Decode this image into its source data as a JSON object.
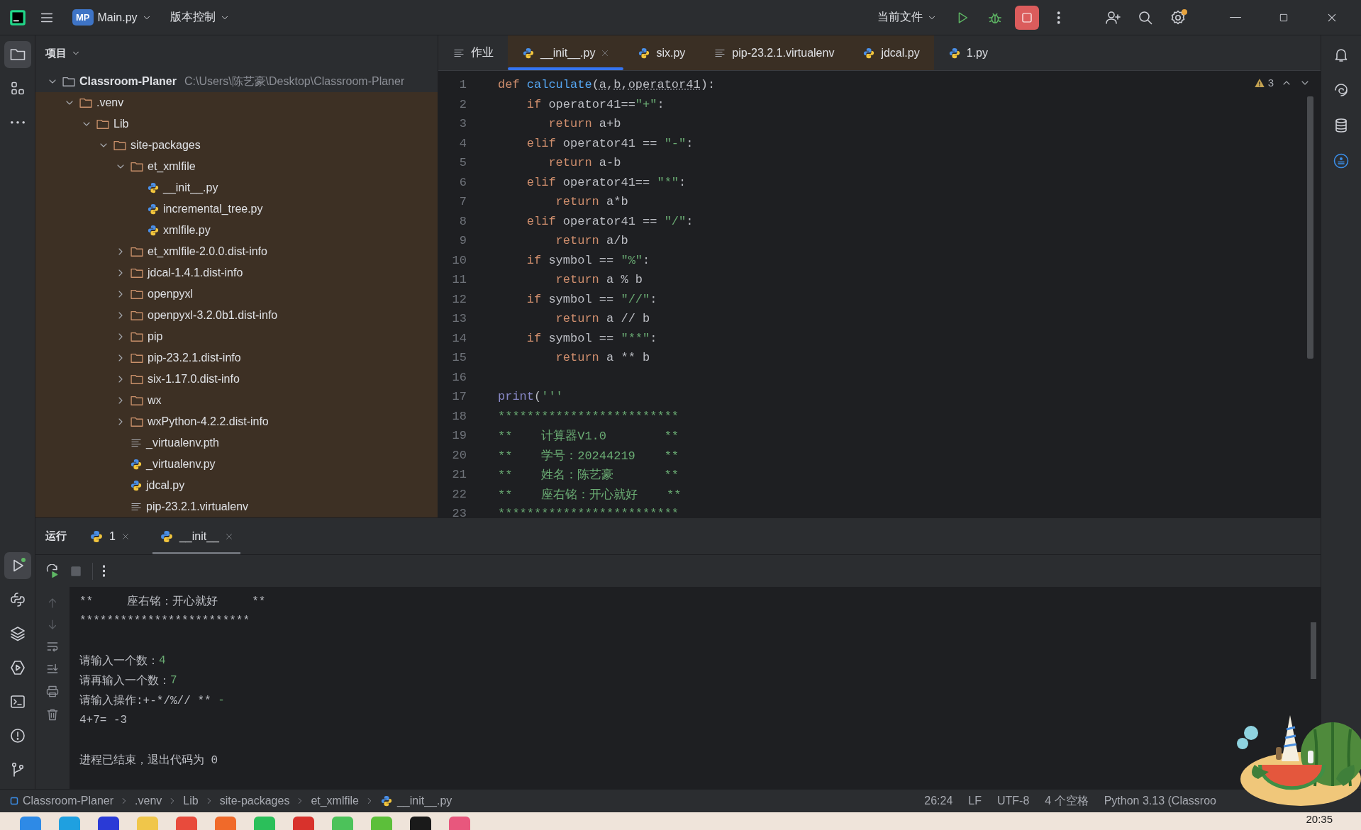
{
  "title_bar": {
    "project_badge": "MP",
    "project": "Main.py",
    "vcs": "版本控制",
    "run_config": "当前文件"
  },
  "left_stripe": {
    "top": [
      {
        "kind": "project",
        "selected": true
      },
      {
        "kind": "structure",
        "selected": false
      },
      {
        "kind": "more",
        "selected": false
      }
    ],
    "bottom": [
      {
        "kind": "run",
        "selected": true
      },
      {
        "kind": "python",
        "selected": false
      },
      {
        "kind": "layers",
        "selected": false
      },
      {
        "kind": "services",
        "selected": false
      },
      {
        "kind": "terminal",
        "selected": false
      },
      {
        "kind": "problems",
        "selected": false
      },
      {
        "kind": "git",
        "selected": false
      }
    ]
  },
  "right_stripe": [
    {
      "kind": "notifications"
    },
    {
      "kind": "ai"
    },
    {
      "kind": "database"
    },
    {
      "kind": "plugin"
    }
  ],
  "project_panel": {
    "title": "项目",
    "tree": [
      {
        "label": "Classroom-Planer",
        "path": "C:\\Users\\陈艺豪\\Desktop\\Classroom-Planer",
        "kind": "folder",
        "expanded": true,
        "children": [
          {
            "label": ".venv",
            "kind": "folder",
            "expanded": true,
            "excluded": true,
            "children": [
              {
                "label": "Lib",
                "kind": "folder",
                "expanded": true,
                "children": [
                  {
                    "label": "site-packages",
                    "kind": "folder",
                    "expanded": true,
                    "children": [
                      {
                        "label": "et_xmlfile",
                        "kind": "folder",
                        "expanded": true,
                        "children": [
                          {
                            "label": "__init__.py",
                            "kind": "python"
                          },
                          {
                            "label": "incremental_tree.py",
                            "kind": "python"
                          },
                          {
                            "label": "xmlfile.py",
                            "kind": "python"
                          }
                        ]
                      },
                      {
                        "label": "et_xmlfile-2.0.0.dist-info",
                        "kind": "folder",
                        "expanded": false
                      },
                      {
                        "label": "jdcal-1.4.1.dist-info",
                        "kind": "folder",
                        "expanded": false
                      },
                      {
                        "label": "openpyxl",
                        "kind": "folder",
                        "expanded": false
                      },
                      {
                        "label": "openpyxl-3.2.0b1.dist-info",
                        "kind": "folder",
                        "expanded": false
                      },
                      {
                        "label": "pip",
                        "kind": "folder",
                        "expanded": false
                      },
                      {
                        "label": "pip-23.2.1.dist-info",
                        "kind": "folder",
                        "expanded": false
                      },
                      {
                        "label": "six-1.17.0.dist-info",
                        "kind": "folder",
                        "expanded": false
                      },
                      {
                        "label": "wx",
                        "kind": "folder",
                        "expanded": false
                      },
                      {
                        "label": "wxPython-4.2.2.dist-info",
                        "kind": "folder",
                        "expanded": false
                      },
                      {
                        "label": "_virtualenv.pth",
                        "kind": "text"
                      },
                      {
                        "label": "_virtualenv.py",
                        "kind": "python"
                      },
                      {
                        "label": "jdcal.py",
                        "kind": "python"
                      },
                      {
                        "label": "pip-23.2.1.virtualenv",
                        "kind": "text"
                      }
                    ]
                  }
                ]
              }
            ]
          }
        ]
      }
    ]
  },
  "editor_tabs": [
    {
      "label": "作业",
      "kind": "text",
      "selected": false,
      "excluded": false
    },
    {
      "label": "__init__.py",
      "kind": "python",
      "selected": true,
      "excluded": true
    },
    {
      "label": "six.py",
      "kind": "python",
      "selected": false,
      "excluded": true
    },
    {
      "label": "pip-23.2.1.virtualenv",
      "kind": "text",
      "selected": false,
      "excluded": true
    },
    {
      "label": "jdcal.py",
      "kind": "python",
      "selected": false,
      "excluded": true
    },
    {
      "label": "1.py",
      "kind": "python",
      "selected": false,
      "excluded": false
    }
  ],
  "editor": {
    "warnings": "3",
    "lines": [
      {
        "number": "1",
        "tokens": [
          {
            "kind": "keyword",
            "text": "def "
          },
          {
            "kind": "function",
            "text": "calculate"
          },
          {
            "kind": "plain",
            "text": "("
          },
          {
            "kind": "param",
            "text": "a"
          },
          {
            "kind": "plain",
            "text": ","
          },
          {
            "kind": "param",
            "text": "b"
          },
          {
            "kind": "plain",
            "text": ","
          },
          {
            "kind": "param",
            "text": "operator41"
          },
          {
            "kind": "plain",
            "text": "):"
          }
        ]
      },
      {
        "number": "2",
        "tokens": [
          {
            "kind": "keyword",
            "text": "    if"
          },
          {
            "kind": "plain",
            "text": " operator41=="
          },
          {
            "kind": "string",
            "text": "\"+\""
          },
          {
            "kind": "plain",
            "text": ":"
          }
        ]
      },
      {
        "number": "3",
        "tokens": [
          {
            "kind": "keyword",
            "text": "       return"
          },
          {
            "kind": "plain",
            "text": " a+b"
          }
        ]
      },
      {
        "number": "4",
        "tokens": [
          {
            "kind": "keyword",
            "text": "    elif"
          },
          {
            "kind": "plain",
            "text": " operator41 == "
          },
          {
            "kind": "string",
            "text": "\"-\""
          },
          {
            "kind": "plain",
            "text": ":"
          }
        ]
      },
      {
        "number": "5",
        "tokens": [
          {
            "kind": "keyword",
            "text": "       return"
          },
          {
            "kind": "plain",
            "text": " a-b"
          }
        ]
      },
      {
        "number": "6",
        "tokens": [
          {
            "kind": "keyword",
            "text": "    elif"
          },
          {
            "kind": "plain",
            "text": " operator41== "
          },
          {
            "kind": "string",
            "text": "\"*\""
          },
          {
            "kind": "plain",
            "text": ":"
          }
        ]
      },
      {
        "number": "7",
        "tokens": [
          {
            "kind": "keyword",
            "text": "        return"
          },
          {
            "kind": "plain",
            "text": " a*b"
          }
        ]
      },
      {
        "number": "8",
        "tokens": [
          {
            "kind": "keyword",
            "text": "    elif"
          },
          {
            "kind": "plain",
            "text": " operator41 == "
          },
          {
            "kind": "string",
            "text": "\"/\""
          },
          {
            "kind": "plain",
            "text": ":"
          }
        ]
      },
      {
        "number": "9",
        "tokens": [
          {
            "kind": "keyword",
            "text": "        return"
          },
          {
            "kind": "plain",
            "text": " a/b"
          }
        ]
      },
      {
        "number": "10",
        "tokens": [
          {
            "kind": "keyword",
            "text": "    if"
          },
          {
            "kind": "plain",
            "text": " symbol == "
          },
          {
            "kind": "string",
            "text": "\"%\""
          },
          {
            "kind": "plain",
            "text": ":"
          }
        ]
      },
      {
        "number": "11",
        "tokens": [
          {
            "kind": "keyword",
            "text": "        return"
          },
          {
            "kind": "plain",
            "text": " a % b"
          }
        ]
      },
      {
        "number": "12",
        "tokens": [
          {
            "kind": "keyword",
            "text": "    if"
          },
          {
            "kind": "plain",
            "text": " symbol == "
          },
          {
            "kind": "string",
            "text": "\"//\""
          },
          {
            "kind": "plain",
            "text": ":"
          }
        ]
      },
      {
        "number": "13",
        "tokens": [
          {
            "kind": "keyword",
            "text": "        return"
          },
          {
            "kind": "plain",
            "text": " a // b"
          }
        ]
      },
      {
        "number": "14",
        "tokens": [
          {
            "kind": "keyword",
            "text": "    if"
          },
          {
            "kind": "plain",
            "text": " symbol == "
          },
          {
            "kind": "string",
            "text": "\"**\""
          },
          {
            "kind": "plain",
            "text": ":"
          }
        ]
      },
      {
        "number": "15",
        "tokens": [
          {
            "kind": "keyword",
            "text": "        return"
          },
          {
            "kind": "plain",
            "text": " a ** b"
          }
        ]
      },
      {
        "number": "16"
      },
      {
        "number": "17",
        "tokens": [
          {
            "kind": "builtin",
            "text": "print"
          },
          {
            "kind": "plain",
            "text": "("
          },
          {
            "kind": "string",
            "text": "'''"
          }
        ]
      },
      {
        "number": "18",
        "tokens": [
          {
            "kind": "string",
            "text": "*************************"
          }
        ]
      },
      {
        "number": "19",
        "tokens": [
          {
            "kind": "string",
            "text": "**    计算器V1.0        **"
          }
        ]
      },
      {
        "number": "20",
        "tokens": [
          {
            "kind": "string",
            "text": "**    学号：20244219    **"
          }
        ]
      },
      {
        "number": "21",
        "tokens": [
          {
            "kind": "string",
            "text": "**    姓名：陈艺豪       **"
          }
        ]
      },
      {
        "number": "22",
        "tokens": [
          {
            "kind": "string",
            "text": "**    座右铭：开心就好    **"
          }
        ]
      },
      {
        "number": "23",
        "tokens": [
          {
            "kind": "string",
            "text": "*************************"
          }
        ]
      }
    ]
  },
  "run_panel": {
    "title": "运行",
    "tabs": [
      {
        "label": "1",
        "selected": false
      },
      {
        "label": "__init__",
        "selected": true
      }
    ],
    "console": [
      {
        "kind": "output",
        "parts": [
          {
            "kind": "output",
            "text": "**     座右铭：开心就好     **"
          }
        ]
      },
      {
        "kind": "output",
        "parts": [
          {
            "kind": "output",
            "text": "*************************"
          }
        ]
      },
      {
        "kind": "blank"
      },
      {
        "kind": "output",
        "parts": [
          {
            "kind": "output",
            "text": "请输入一个数："
          },
          {
            "kind": "input",
            "text": "4"
          }
        ]
      },
      {
        "kind": "output",
        "parts": [
          {
            "kind": "output",
            "text": "请再输入一个数："
          },
          {
            "kind": "input",
            "text": "7"
          }
        ]
      },
      {
        "kind": "output",
        "parts": [
          {
            "kind": "output",
            "text": "请输入操作:+-*/%// ** "
          },
          {
            "kind": "input",
            "text": "-"
          }
        ]
      },
      {
        "kind": "output",
        "parts": [
          {
            "kind": "output",
            "text": "4+7= -3"
          }
        ]
      },
      {
        "kind": "blank"
      },
      {
        "kind": "output",
        "parts": [
          {
            "kind": "output",
            "text": "进程已结束，退出代码为 0"
          }
        ]
      }
    ]
  },
  "status_bar": {
    "breadcrumbs": [
      {
        "kind": "module",
        "label": "Classroom-Planer"
      },
      {
        "kind": "folder",
        "label": ".venv"
      },
      {
        "kind": "folder",
        "label": "Lib"
      },
      {
        "kind": "folder",
        "label": "site-packages"
      },
      {
        "kind": "folder",
        "label": "et_xmlfile"
      },
      {
        "kind": "python",
        "label": "__init__.py"
      }
    ],
    "items": [
      "26:24",
      "LF",
      "UTF-8",
      "4 个空格",
      "Python 3.13 (Classroo"
    ]
  },
  "taskbar": {
    "clock": "20:35"
  }
}
